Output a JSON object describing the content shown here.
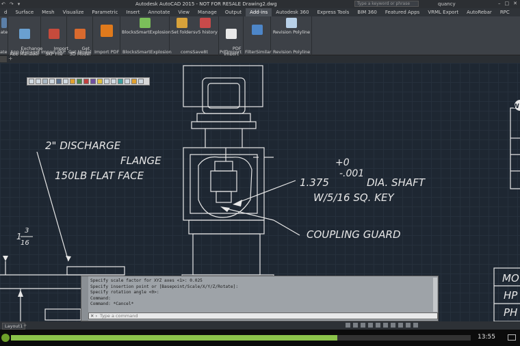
{
  "titlebar": {
    "title": "Autodesk AutoCAD 2015 - NOT FOR RESALE   Drawing2.dwg",
    "search_placeholder": "Type a keyword or phrase",
    "user": "quancy"
  },
  "tabs": [
    {
      "label": "d"
    },
    {
      "label": "Surface"
    },
    {
      "label": "Mesh"
    },
    {
      "label": "Visualize"
    },
    {
      "label": "Parametric"
    },
    {
      "label": "Insert"
    },
    {
      "label": "Annotate"
    },
    {
      "label": "View"
    },
    {
      "label": "Manage"
    },
    {
      "label": "Output"
    },
    {
      "label": "Add-ins"
    },
    {
      "label": "Autodesk 360"
    },
    {
      "label": "Express Tools"
    },
    {
      "label": "BIM 360"
    },
    {
      "label": "Featured Apps"
    },
    {
      "label": "VRML Export"
    },
    {
      "label": "AutoRebar"
    },
    {
      "label": "RPC"
    }
  ],
  "ribbon": {
    "buttons": {
      "b0": "ate",
      "b1": "Exchange\nApp Manager",
      "b2": "Import\nSKP File",
      "b3": "Get\n3D Model",
      "b4": "",
      "b5": "BlocksSmartExplosion",
      "b6": "Set folder",
      "b7": "sv5 history",
      "b8": "PDF\nImport",
      "b9": "",
      "b10": "Revision Polyline"
    },
    "panels": {
      "p0": "ate",
      "p1": "App Manager",
      "p2": "Import SKP",
      "p3": "Get Model",
      "p4": "Import PDF",
      "p5": "BlocksSmartExplosion",
      "p6": "comsSave8t",
      "p7": "PdfImport",
      "p8": "FilterSimilar",
      "p9": "Revision Polyline"
    }
  },
  "drawing": {
    "discharge_l1": "2\" DISCHARGE",
    "discharge_l2": "FLANGE",
    "discharge_l3": "150LB FLAT FACE",
    "tol_plus": "+0",
    "tol_minus": "-.001",
    "shaft_l1": "1.375",
    "shaft_l2": "DIA. SHAFT",
    "shaft_l3": "W/5/16 SQ. KEY",
    "coupling": "COUPLING GUARD",
    "frac_whole": "1",
    "frac_num": "3",
    "frac_den": "16",
    "table_r1": "MO",
    "table_r2": "HP",
    "table_r3": "PH",
    "edge_w": "W"
  },
  "command": {
    "history": [
      "Specify scale factor for XYZ axes <1>: 0.025",
      "Specify insertion point or [Basepoint/Scale/X/Y/Z/Rotate]:",
      "Specify rotation angle <0>:",
      "Command:",
      "Command: *Cancel*"
    ],
    "placeholder": "Type a command"
  },
  "status": {
    "layout_tab": "Layout1",
    "layout_tab2": "+"
  },
  "player": {
    "time": "13:55",
    "progress": 0.71,
    "colors": {
      "fill": "#8bc34a"
    }
  }
}
